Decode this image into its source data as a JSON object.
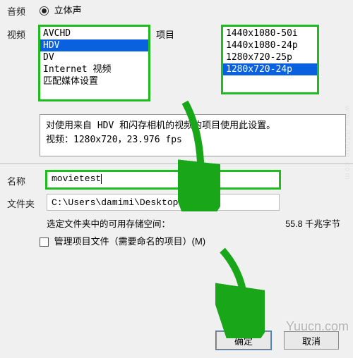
{
  "labels": {
    "audio": "音频",
    "video": "视频",
    "project": "项目",
    "name": "名称",
    "folder": "文件夹"
  },
  "radio": {
    "stereo": "立体声"
  },
  "video_list": {
    "items": [
      "AVCHD",
      "HDV",
      "DV",
      "Internet 视频",
      "匹配媒体设置"
    ],
    "selected_index": 1
  },
  "project_list": {
    "items": [
      "1440x1080-50i",
      "1440x1080-24p",
      "1280x720-25p",
      "1280x720-24p"
    ],
    "selected_index": 3
  },
  "description": {
    "line1": "对使用来自 HDV 和闪存相机的视频的项目使用此设置。",
    "line2": "视频：1280x720，23.976 fps"
  },
  "name_field": {
    "value": "movietest"
  },
  "folder_field": {
    "value": "C:\\Users\\damimi\\Desktop\\"
  },
  "space": {
    "label": "选定文件夹中的可用存储空间：",
    "value": "55.8 千兆字节"
  },
  "checkbox": {
    "label": "管理项目文件（需要命名的项目）(M)"
  },
  "buttons": {
    "ok": "确定",
    "cancel": "取消"
  },
  "watermark": "Yuucn.com",
  "colors": {
    "highlight": "#1fbc1f",
    "selection": "#0a61e0",
    "arrow": "#19a619"
  }
}
